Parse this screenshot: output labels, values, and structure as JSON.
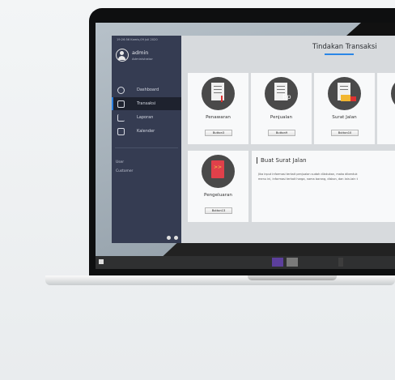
{
  "sidebar": {
    "datetime": "19:26:56  Kamis,09 Juli 2020",
    "user_name": "admin",
    "user_role": "Administrator",
    "items": [
      {
        "label": "Dashboard",
        "icon": "dashboard-icon"
      },
      {
        "label": "Transaksi",
        "icon": "transaction-icon",
        "active": true
      },
      {
        "label": "Laporan",
        "icon": "chart-icon"
      },
      {
        "label": "Kalender",
        "icon": "calendar-icon"
      }
    ],
    "links": [
      "User",
      "Customer"
    ]
  },
  "main": {
    "title": "Tindakan Transaksi",
    "cards": [
      {
        "label": "Penawaran",
        "button": "Button3"
      },
      {
        "label": "Penjualan",
        "button": "Button9",
        "icon_text": "Rp"
      },
      {
        "label": "Surat Jalan",
        "button": "Button10"
      },
      {
        "label": "Pengeluaran",
        "button": "Button13",
        "icon_text": ">>"
      }
    ],
    "panel": {
      "title": "Buat Surat Jalan",
      "line1": "Jika input informasi terkait penjualan sudah dilakukan, maka dibentuk",
      "line2": "menu ini, informasi terkait harga, nama barang, diskon, dan lain-lain t"
    }
  },
  "colors": {
    "sidebar": "#353c52",
    "accent": "#2a86e6",
    "active_bg": "#1e222e"
  }
}
